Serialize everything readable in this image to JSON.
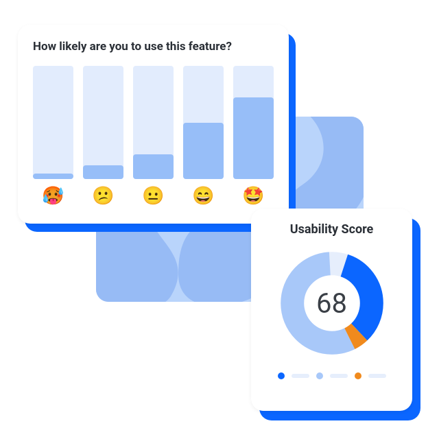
{
  "survey": {
    "title": "How likely are you to use this feature?",
    "emojis": [
      "🥵",
      "😕",
      "😐",
      "😄",
      "🤩"
    ]
  },
  "score": {
    "title": "Usability Score",
    "value": "68"
  },
  "colors": {
    "blue": "#0b66ff",
    "lightblue": "#a8c8f9",
    "orange": "#f08a1d",
    "track": "#e6eefc"
  },
  "chart_data": [
    {
      "type": "bar",
      "title": "How likely are you to use this feature?",
      "categories": [
        "🥵",
        "😕",
        "😐",
        "😄",
        "🤩"
      ],
      "values": [
        5,
        12,
        22,
        50,
        72
      ],
      "ylim": [
        0,
        100
      ],
      "xlabel": "",
      "ylabel": ""
    },
    {
      "type": "pie",
      "title": "Usability Score",
      "center_value": 68,
      "series": [
        {
          "name": "blue",
          "value": 35,
          "color": "#0b66ff"
        },
        {
          "name": "orange",
          "value": 5,
          "color": "#f08a1d"
        },
        {
          "name": "lightblue",
          "value": 60,
          "color": "#a8c8f9"
        }
      ],
      "legend": [
        "blue",
        "lightblue",
        "orange"
      ]
    }
  ]
}
